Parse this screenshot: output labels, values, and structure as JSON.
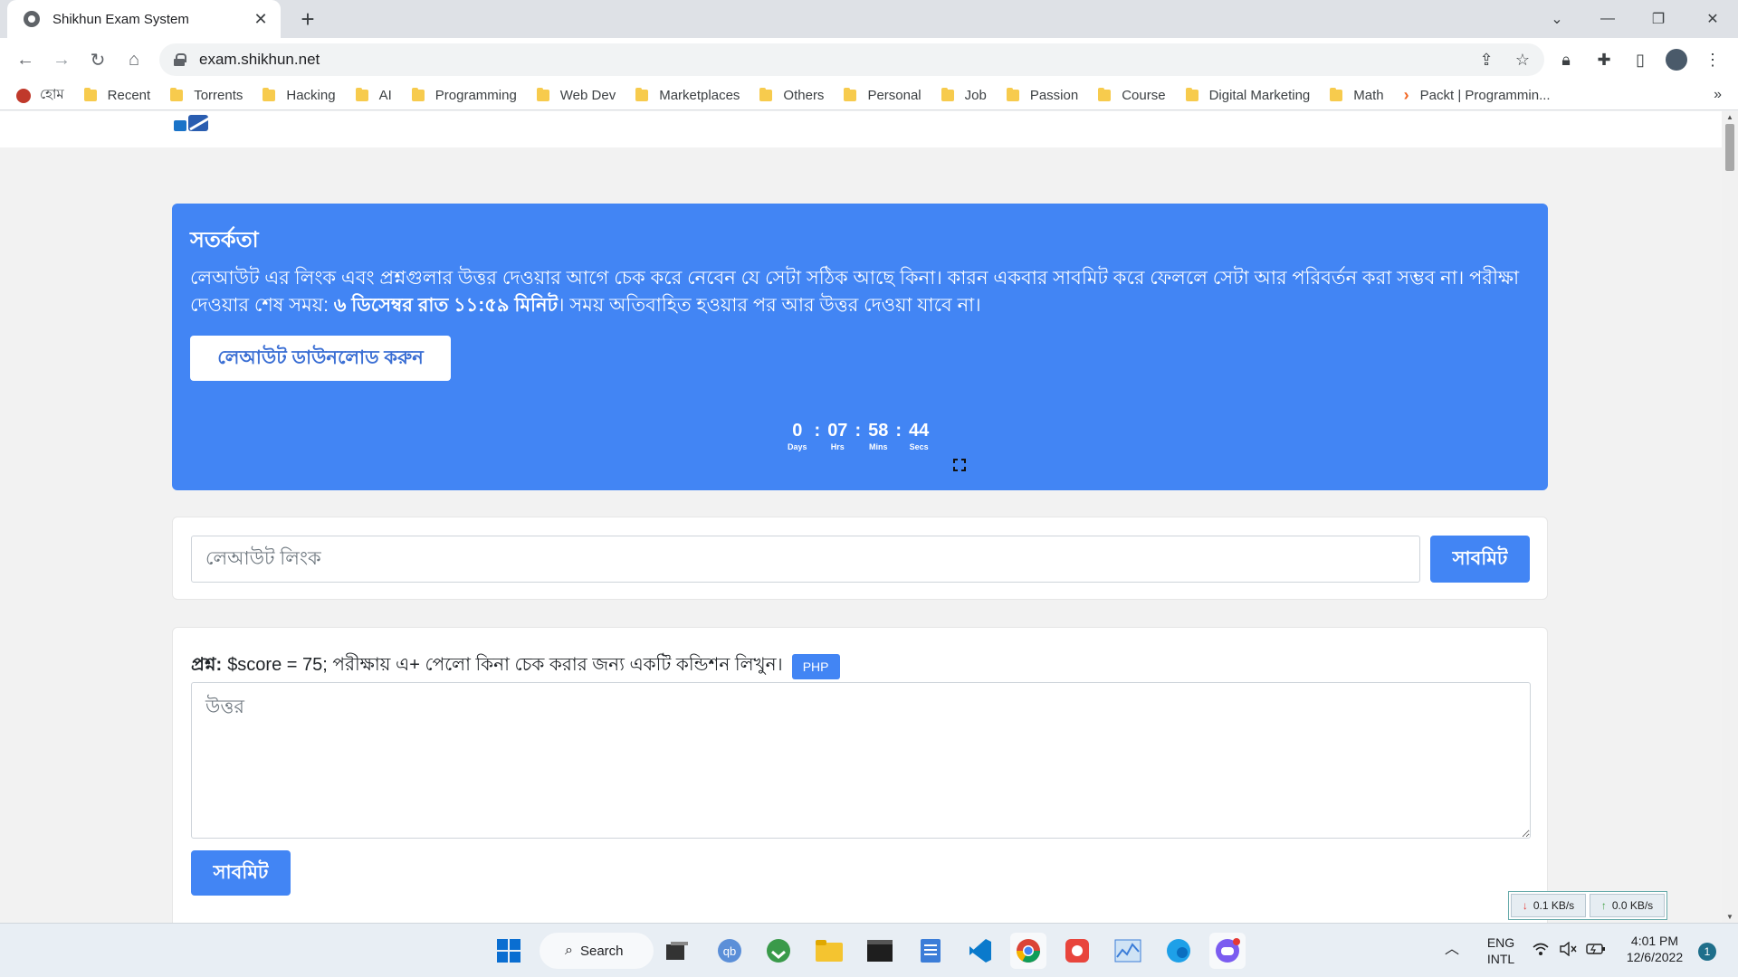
{
  "browser": {
    "tab_title": "Shikhun Exam System",
    "tab_close": "✕",
    "new_tab": "+",
    "url": "exam.shikhun.net"
  },
  "bookmarks": [
    {
      "label": "হোম",
      "icon": "home-flag-icon"
    },
    {
      "label": "Recent",
      "icon": "folder-icon"
    },
    {
      "label": "Torrents",
      "icon": "folder-icon"
    },
    {
      "label": "Hacking",
      "icon": "folder-icon"
    },
    {
      "label": "AI",
      "icon": "folder-icon"
    },
    {
      "label": "Programming",
      "icon": "folder-icon"
    },
    {
      "label": "Web Dev",
      "icon": "folder-icon"
    },
    {
      "label": "Marketplaces",
      "icon": "folder-icon"
    },
    {
      "label": "Others",
      "icon": "folder-icon"
    },
    {
      "label": "Personal",
      "icon": "folder-icon"
    },
    {
      "label": "Job",
      "icon": "folder-icon"
    },
    {
      "label": "Passion",
      "icon": "folder-icon"
    },
    {
      "label": "Course",
      "icon": "folder-icon"
    },
    {
      "label": "Digital Marketing",
      "icon": "folder-icon"
    },
    {
      "label": "Math",
      "icon": "folder-icon"
    },
    {
      "label": "Packt | Programmin...",
      "icon": "packt-icon"
    }
  ],
  "alert": {
    "title": "সতর্কতা",
    "line1": "লেআউট এর লিংক এবং প্রশ্নগুলার উত্তর দেওয়ার আগে চেক করে নেবেন যে সেটা সঠিক আছে কিনা। কারন একবার সাবমিট করে ফেললে সেটা আর পরিবর্তন করা সম্ভব না।",
    "deadline_prefix": "পরীক্ষা দেওয়ার শেষ সময়: ",
    "deadline": "৬ ডিসেম্বর রাত ১১:৫৯ মিনিট",
    "deadline_suffix": "। সময় অতিবাহিত হওয়ার পর আর উত্তর দেওয়া যাবে না।",
    "download_button": "লেআউট ডাউনলোড করুন"
  },
  "countdown": {
    "days": "0",
    "days_label": "Days",
    "hrs": "07",
    "hrs_label": "Hrs",
    "mins": "58",
    "mins_label": "Mins",
    "secs": "44",
    "secs_label": "Secs",
    "separator": ":"
  },
  "link_form": {
    "placeholder": "লেআউট লিংক",
    "submit": "সাবমিট"
  },
  "question": {
    "label": "প্রশ্ন:",
    "text": "$score = 75; পরীক্ষায় এ+ পেলো কিনা চেক করার জন্য একটি কন্ডিশন লিখুন।",
    "badge": "PHP",
    "answer_placeholder": "উত্তর",
    "submit": "সাবমিট"
  },
  "netspeed": {
    "down": "0.1 KB/s",
    "up": "0.0 KB/s"
  },
  "taskbar": {
    "search": "Search",
    "lang_top": "ENG",
    "lang_bottom": "INTL",
    "time": "4:01 PM",
    "date": "12/6/2022",
    "notifications": "1"
  },
  "colors": {
    "primary": "#4285f4",
    "page_bg": "#f2f2f2"
  }
}
